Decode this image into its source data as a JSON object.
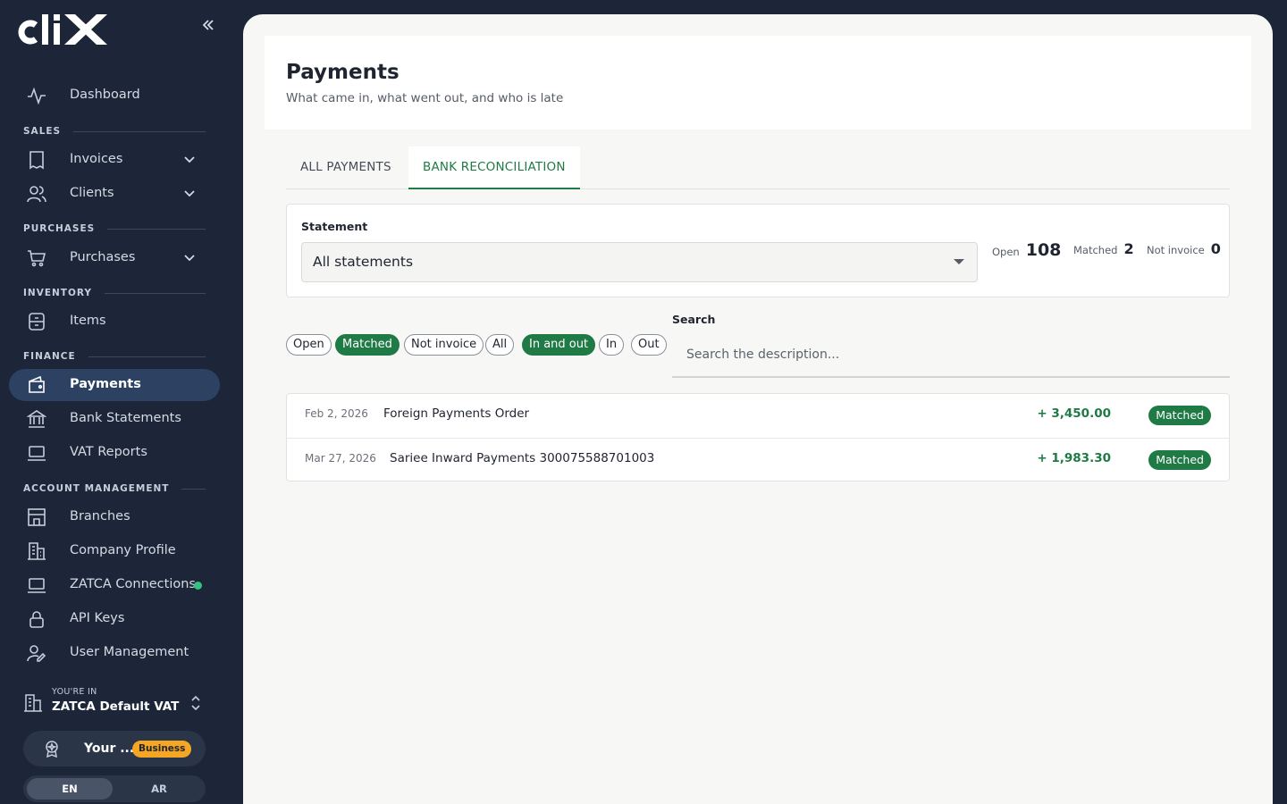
{
  "sidebar": {
    "brand": "clix",
    "collapse_icon": "double-chevron-left-icon",
    "items": {
      "dashboard": "Dashboard",
      "invoices": "Invoices",
      "clients": "Clients",
      "purchases": "Purchases",
      "items": "Items",
      "payments": "Payments",
      "bank_statements": "Bank Statements",
      "vat_reports": "VAT Reports",
      "branches": "Branches",
      "company_profile": "Company Profile",
      "zatca_connections": "ZATCA Connections",
      "api_keys": "API Keys",
      "user_management": "User Management"
    },
    "sections": {
      "sales": "SALES",
      "purchases": "PURCHASES",
      "inventory": "INVENTORY",
      "finance": "FINANCE",
      "account_management": "ACCOUNT MANAGEMENT"
    },
    "active_item": "Payments",
    "zatca_status_color": "#35c27f",
    "tenant": {
      "caption": "YOU'RE IN",
      "name": "ZATCA Default VAT"
    },
    "plan": {
      "text": "Your ...",
      "badge": "Business"
    },
    "lang": {
      "en": "EN",
      "ar": "AR",
      "selected": "EN"
    }
  },
  "page": {
    "title": "Payments",
    "subtitle": "What came in, what went out, and who is late"
  },
  "tabs": {
    "all": "ALL PAYMENTS",
    "bank": "BANK RECONCILIATION",
    "active": "BANK RECONCILIATION"
  },
  "statement": {
    "label": "Statement",
    "selected": "All statements",
    "stats": {
      "open_label": "Open",
      "open": "108",
      "matched_label": "Matched",
      "matched": "2",
      "notinv_label": "Not invoice",
      "notinv": "0"
    }
  },
  "filters": {
    "status": {
      "open": "Open",
      "matched": "Matched",
      "not_invoice": "Not invoice",
      "all": "All",
      "selected": "Matched"
    },
    "direction": {
      "in_and_out": "In and out",
      "in": "In",
      "out": "Out",
      "selected": "In and out"
    }
  },
  "search": {
    "label": "Search",
    "placeholder": "Search the description...",
    "value": ""
  },
  "transactions": [
    {
      "date": "Feb 2, 2026",
      "description": "Foreign Payments Order",
      "amount": "+ 3,450.00",
      "status": "Matched"
    },
    {
      "date": "Mar 27, 2026",
      "description": "Sariee Inward Payments 300075588701003",
      "amount": "+ 1,983.30",
      "status": "Matched"
    }
  ],
  "colors": {
    "sidebar_bg": "#1c2638",
    "accent_green": "#1f7a45",
    "active_nav": "#2d4263",
    "badge_orange": "#f5a623"
  }
}
